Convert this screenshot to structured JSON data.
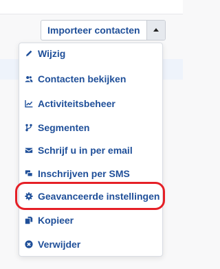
{
  "toolbar": {
    "import_button_label": "Importeer contacten"
  },
  "menu": {
    "items": [
      {
        "label": "Wijzig",
        "icon": "pencil-icon"
      },
      {
        "label": "Contacten bekijken",
        "icon": "users-icon"
      },
      {
        "label": "Activiteitsbeheer",
        "icon": "activity-chart-icon"
      },
      {
        "label": "Segmenten",
        "icon": "segments-icon"
      },
      {
        "label": "Schrijf u in per email",
        "icon": "envelope-icon"
      },
      {
        "label": "Inschrijven per SMS",
        "icon": "sms-icon"
      },
      {
        "label": "Geavanceerde instellingen",
        "icon": "gear-icon"
      },
      {
        "label": "Kopieer",
        "icon": "copy-icon"
      },
      {
        "label": "Verwijder",
        "icon": "remove-icon"
      }
    ]
  },
  "colors": {
    "link": "#1f4f99",
    "highlight": "#e51f26"
  }
}
